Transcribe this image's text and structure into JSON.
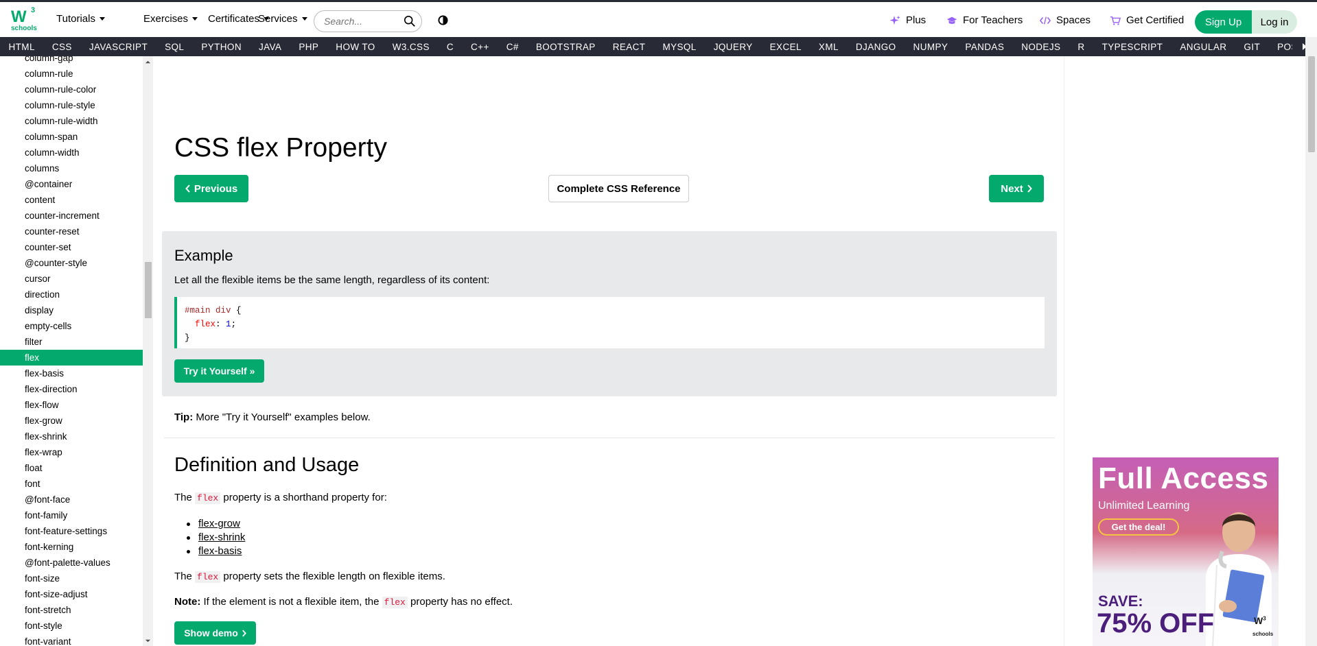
{
  "brand": {
    "logo_main": "W",
    "logo_sup": "3",
    "logo_sub": "schools"
  },
  "topnav": {
    "menus": [
      "Tutorials",
      "Exercises",
      "Certificates",
      "Services"
    ],
    "search_placeholder": "Search...",
    "right_links": [
      "Plus",
      "For Teachers",
      "Spaces",
      "Get Certified"
    ],
    "signup": "Sign Up",
    "login": "Log in"
  },
  "subjects": [
    "HTML",
    "CSS",
    "JAVASCRIPT",
    "SQL",
    "PYTHON",
    "JAVA",
    "PHP",
    "HOW TO",
    "W3.CSS",
    "C",
    "C++",
    "C#",
    "BOOTSTRAP",
    "REACT",
    "MYSQL",
    "JQUERY",
    "EXCEL",
    "XML",
    "DJANGO",
    "NUMPY",
    "PANDAS",
    "NODEJS",
    "R",
    "TYPESCRIPT",
    "ANGULAR",
    "GIT",
    "POSTGRES"
  ],
  "sidebar": {
    "items": [
      "column-gap",
      "column-rule",
      "column-rule-color",
      "column-rule-style",
      "column-rule-width",
      "column-span",
      "column-width",
      "columns",
      "@container",
      "content",
      "counter-increment",
      "counter-reset",
      "counter-set",
      "@counter-style",
      "cursor",
      "direction",
      "display",
      "empty-cells",
      "filter",
      "flex",
      "flex-basis",
      "flex-direction",
      "flex-flow",
      "flex-grow",
      "flex-shrink",
      "flex-wrap",
      "float",
      "font",
      "@font-face",
      "font-family",
      "font-feature-settings",
      "font-kerning",
      "@font-palette-values",
      "font-size",
      "font-size-adjust",
      "font-stretch",
      "font-style",
      "font-variant"
    ],
    "active": "flex"
  },
  "main": {
    "title": "CSS flex Property",
    "prev": "Previous",
    "reference": "Complete CSS Reference",
    "next": "Next",
    "example": {
      "heading": "Example",
      "text": "Let all the flexible items be the same length, regardless of its content:",
      "code_selector": "#main div",
      "code_open": " {",
      "code_prop": "flex",
      "code_colon": ": ",
      "code_value": "1",
      "code_semi": ";",
      "code_close": "}",
      "try_button": "Try it Yourself »"
    },
    "tip_label": "Tip:",
    "tip_text": " More \"Try it Yourself\" examples below.",
    "definition_heading": "Definition and Usage",
    "def_p1_pre": "The ",
    "def_p1_kw": "flex",
    "def_p1_post": " property is a shorthand property for:",
    "def_links": [
      "flex-grow",
      "flex-shrink",
      "flex-basis"
    ],
    "def_p2_pre": "The ",
    "def_p2_kw": "flex",
    "def_p2_post": " property sets the flexible length on flexible items.",
    "note_label": "Note:",
    "note_pre": " If the element is not a flexible item, the ",
    "note_kw": "flex",
    "note_post": " property has no effect.",
    "demo_button": "Show demo"
  },
  "ad": {
    "title": "Full Access",
    "subtitle": "Unlimited Learning",
    "deal": "Get the deal!",
    "save": "SAVE:",
    "percent": "75% OFF",
    "logo": "W",
    "logo_sup": "3",
    "logo_sub": "schools"
  },
  "colors": {
    "accent": "#04aa6d",
    "dark_bar": "#282a35",
    "example_bg": "#e7e9eb"
  }
}
